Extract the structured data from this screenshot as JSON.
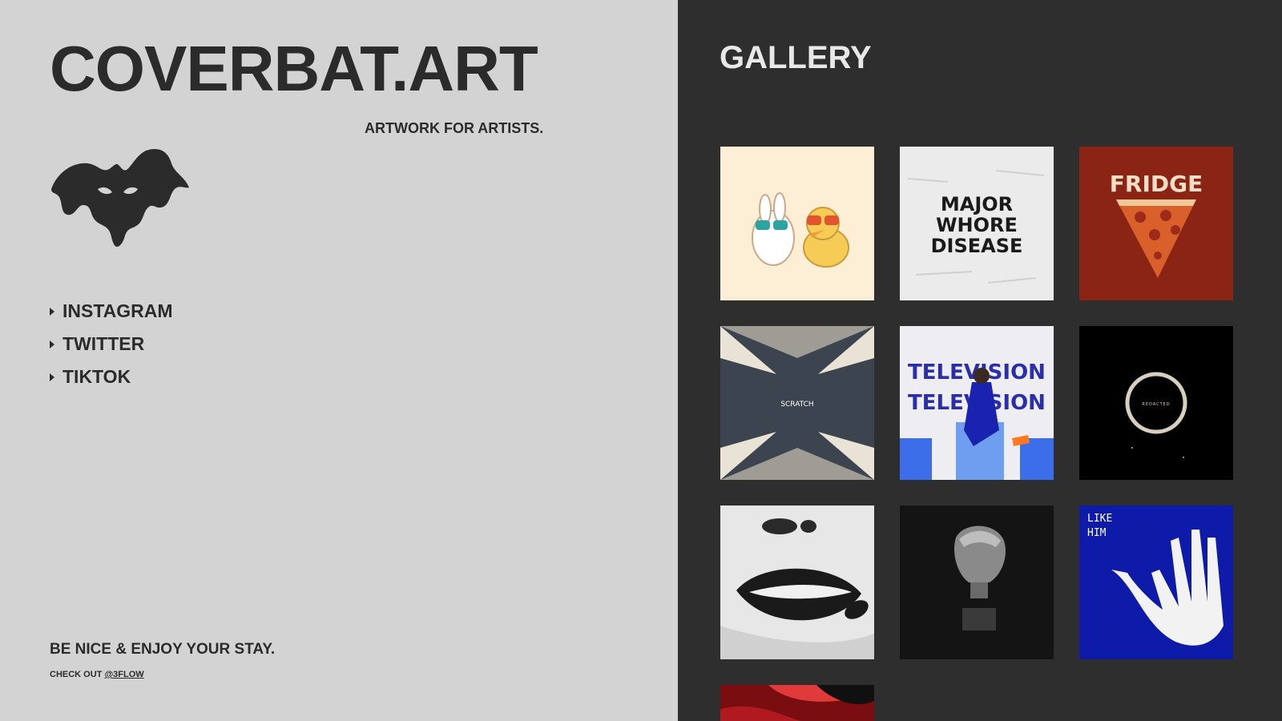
{
  "brand": {
    "title": "COVERBAT.ART",
    "tagline": "ARTWORK FOR ARTISTS."
  },
  "social": [
    {
      "label": "INSTAGRAM",
      "icon": "triangle-right-icon"
    },
    {
      "label": "TWITTER",
      "icon": "triangle-right-icon"
    },
    {
      "label": "TIKTOK",
      "icon": "triangle-right-icon"
    }
  ],
  "footer": {
    "message": "BE NICE & ENJOY YOUR STAY.",
    "checkout_prefix": "CHECK OUT",
    "checkout_handle": "@3FLOW"
  },
  "gallery": {
    "title": "GALLERY",
    "art_text": {
      "major": [
        "MAJOR",
        "WHORE",
        "DISEASE"
      ],
      "fridge": "FRIDGE",
      "scratch": "SCRATCH",
      "television": "TELEVISION",
      "redacted": "REDACTED",
      "like_him": [
        "LIKE",
        "HIM"
      ]
    }
  },
  "colors": {
    "left_bg": "#d3d3d3",
    "right_bg": "#2e2e2e",
    "text_dark": "#2b2b2b"
  }
}
